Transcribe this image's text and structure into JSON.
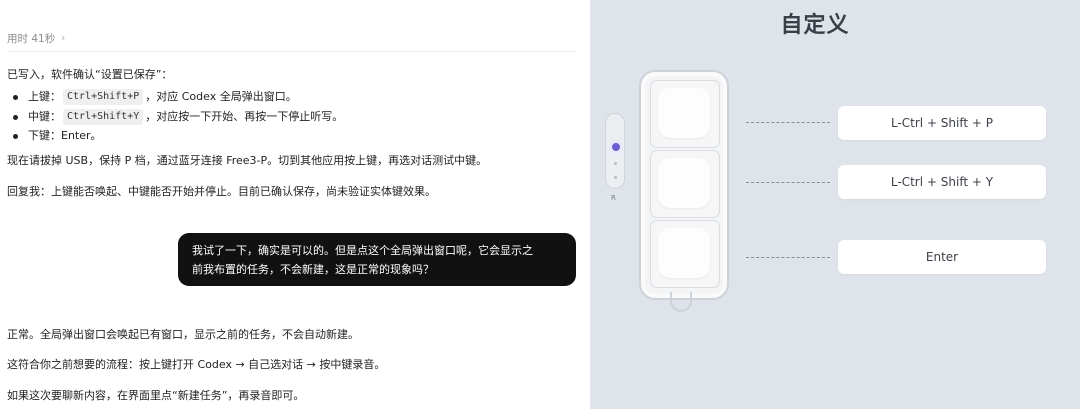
{
  "chat": {
    "elapsed": "用时 41秒",
    "written_confirm": "已写入，软件确认“设置已保存”：",
    "bullets": [
      {
        "name": "上键",
        "pre": "上键：",
        "code": "Ctrl+Shift+P",
        "post": "，对应 Codex 全局弹出窗口。"
      },
      {
        "name": "中键",
        "pre": "中键：",
        "code": "Ctrl+Shift+Y",
        "post": "，对应按一下开始、再按一下停止听写。"
      },
      {
        "name": "下键",
        "pre": "下键：Enter。",
        "code": "",
        "post": ""
      }
    ],
    "instruction": "现在请拔掉 USB，保持 P 档，通过蓝牙连接 Free3-P。切到其他应用按上键，再选对话测试中键。",
    "reply_request": "回复我：上键能否唤起、中键能否开始并停止。目前已确认保存，尚未验证实体键效果。",
    "user_message_line1": "我试了一下，确实是可以的。但是点这个全局弹出窗口呢，它会显示之",
    "user_message_line2": "前我布置的任务，不会新建，这是正常的现象吗？",
    "answer_1": "正常。全局弹出窗口会唤起已有窗口，显示之前的任务，不会自动新建。",
    "answer_2": "这符合你之前想要的流程：按上键打开 Codex → 自己选对话 → 按中键录音。",
    "answer_3": "如果这次要聊新内容，在界面里点“新建任务”，再录音即可。"
  },
  "customize": {
    "title": "自定义",
    "mode_top": "P",
    "mode_bottom": "R",
    "mode_selected": "P",
    "bindings": [
      {
        "key": "top",
        "label": "L-Ctrl + Shift + P"
      },
      {
        "key": "middle",
        "label": "L-Ctrl + Shift + Y"
      },
      {
        "key": "bottom",
        "label": "Enter"
      }
    ],
    "accent": "#6b5fcf",
    "panel_bg": "#dfe3ea"
  }
}
